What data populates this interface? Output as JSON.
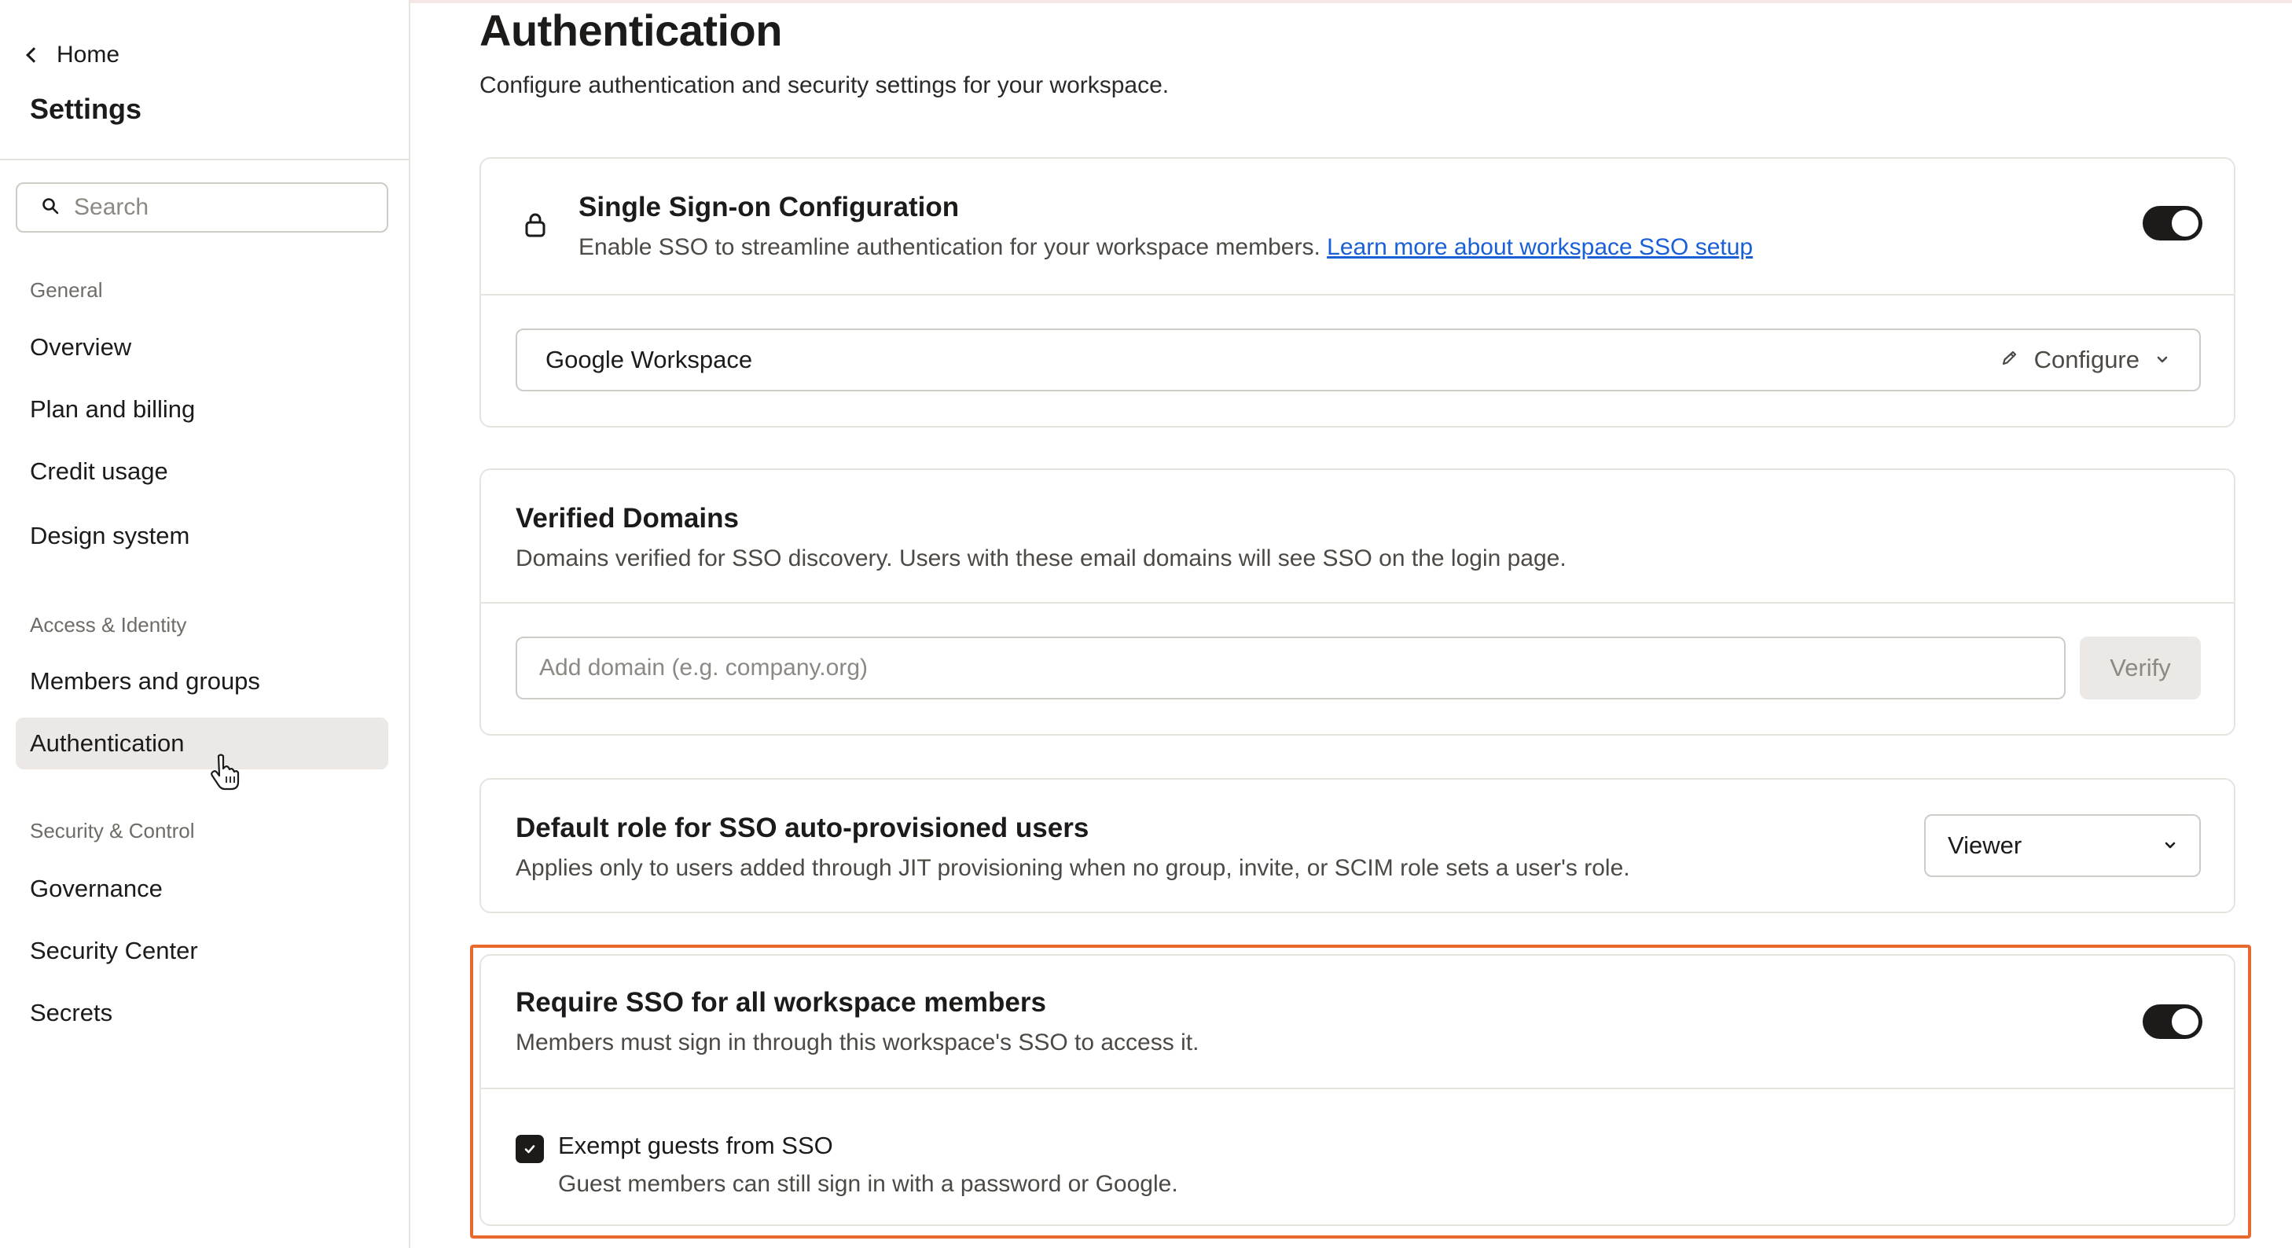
{
  "nav": {
    "home_label": "Home",
    "settings_title": "Settings",
    "search_placeholder": "Search",
    "sections": [
      {
        "label": "General",
        "items": [
          "Overview",
          "Plan and billing",
          "Credit usage",
          "Design system"
        ]
      },
      {
        "label": "Access & Identity",
        "items": [
          "Members and groups",
          "Authentication"
        ]
      },
      {
        "label": "Security & Control",
        "items": [
          "Governance",
          "Security Center",
          "Secrets"
        ]
      }
    ],
    "active_item": "Authentication"
  },
  "page": {
    "title": "Authentication",
    "subtitle": "Configure authentication and security settings for your workspace."
  },
  "sso": {
    "title": "Single Sign-on Configuration",
    "description": "Enable SSO to streamline authentication for your workspace members.",
    "link_text": "Learn more about workspace SSO setup",
    "enabled": true,
    "provider": "Google Workspace",
    "configure_label": "Configure"
  },
  "domains": {
    "title": "Verified Domains",
    "description": "Domains verified for SSO discovery. Users with these email domains will see SSO on the login page.",
    "input_placeholder": "Add domain (e.g. company.org)",
    "verify_label": "Verify"
  },
  "default_role": {
    "title": "Default role for SSO auto-provisioned users",
    "description": "Applies only to users added through JIT provisioning when no group, invite, or SCIM role sets a user's role.",
    "selected": "Viewer"
  },
  "require_sso": {
    "title": "Require SSO for all workspace members",
    "description": "Members must sign in through this workspace's SSO to access it.",
    "enabled": true,
    "exempt_label": "Exempt guests from SSO",
    "exempt_description": "Guest members can still sign in with a password or Google.",
    "exempt_checked": true
  },
  "colors": {
    "highlight": "#e8692e",
    "link": "#1a5fd6",
    "toggle_on": "#1c1b1a"
  }
}
